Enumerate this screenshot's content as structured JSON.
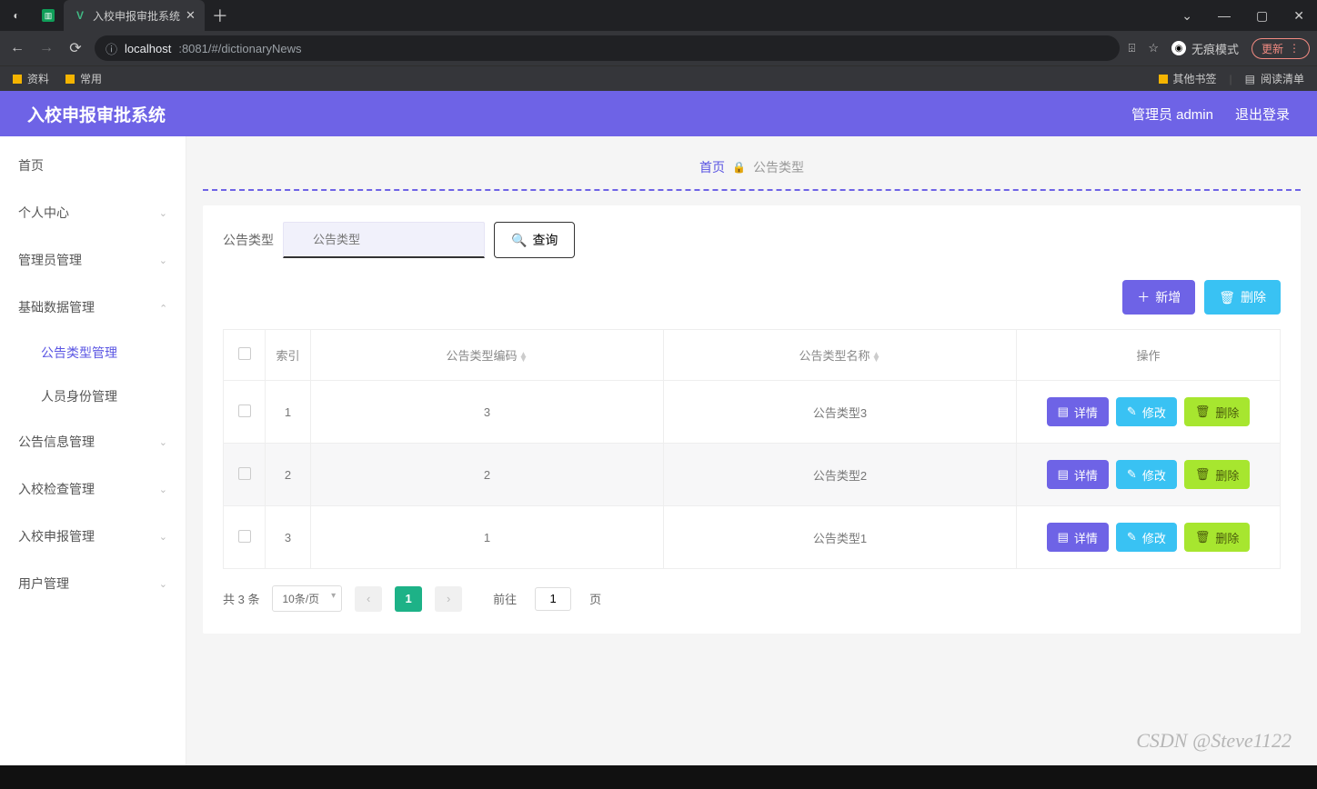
{
  "browser": {
    "tab_title": "入校申报审批系统",
    "address": {
      "host": "localhost",
      "port_path": ":8081/#/dictionaryNews"
    },
    "incognito_label": "无痕模式",
    "update_label": "更新",
    "bookmarks": {
      "b1": "资料",
      "b2": "常用",
      "other": "其他书签",
      "reading": "阅读清单"
    }
  },
  "app": {
    "title": "入校申报审批系统",
    "user_label": "管理员 admin",
    "logout_label": "退出登录"
  },
  "sidebar": {
    "items": [
      {
        "label": "首页",
        "expandable": false
      },
      {
        "label": "个人中心",
        "expandable": true
      },
      {
        "label": "管理员管理",
        "expandable": true
      },
      {
        "label": "基础数据管理",
        "expandable": true,
        "open": true,
        "children": [
          {
            "label": "公告类型管理",
            "active": true
          },
          {
            "label": "人员身份管理",
            "active": false
          }
        ]
      },
      {
        "label": "公告信息管理",
        "expandable": true
      },
      {
        "label": "入校检查管理",
        "expandable": true
      },
      {
        "label": "入校申报管理",
        "expandable": true
      },
      {
        "label": "用户管理",
        "expandable": true
      }
    ]
  },
  "breadcrumb": {
    "home": "首页",
    "current": "公告类型"
  },
  "search": {
    "label": "公告类型",
    "placeholder": "公告类型",
    "query_btn": "查询"
  },
  "toolbar": {
    "add_label": "新增",
    "delete_label": "删除"
  },
  "table": {
    "headers": {
      "index": "索引",
      "code": "公告类型编码",
      "name": "公告类型名称",
      "ops": "操作"
    },
    "row_actions": {
      "detail": "详情",
      "edit": "修改",
      "delete": "删除"
    },
    "rows": [
      {
        "index": "1",
        "code": "3",
        "name": "公告类型3"
      },
      {
        "index": "2",
        "code": "2",
        "name": "公告类型2"
      },
      {
        "index": "3",
        "code": "1",
        "name": "公告类型1"
      }
    ]
  },
  "pager": {
    "total_text": "共 3 条",
    "page_size": "10条/页",
    "current_page": "1",
    "goto_prefix": "前往",
    "goto_value": "1",
    "goto_suffix": "页"
  },
  "watermark": "CSDN @Steve1122"
}
